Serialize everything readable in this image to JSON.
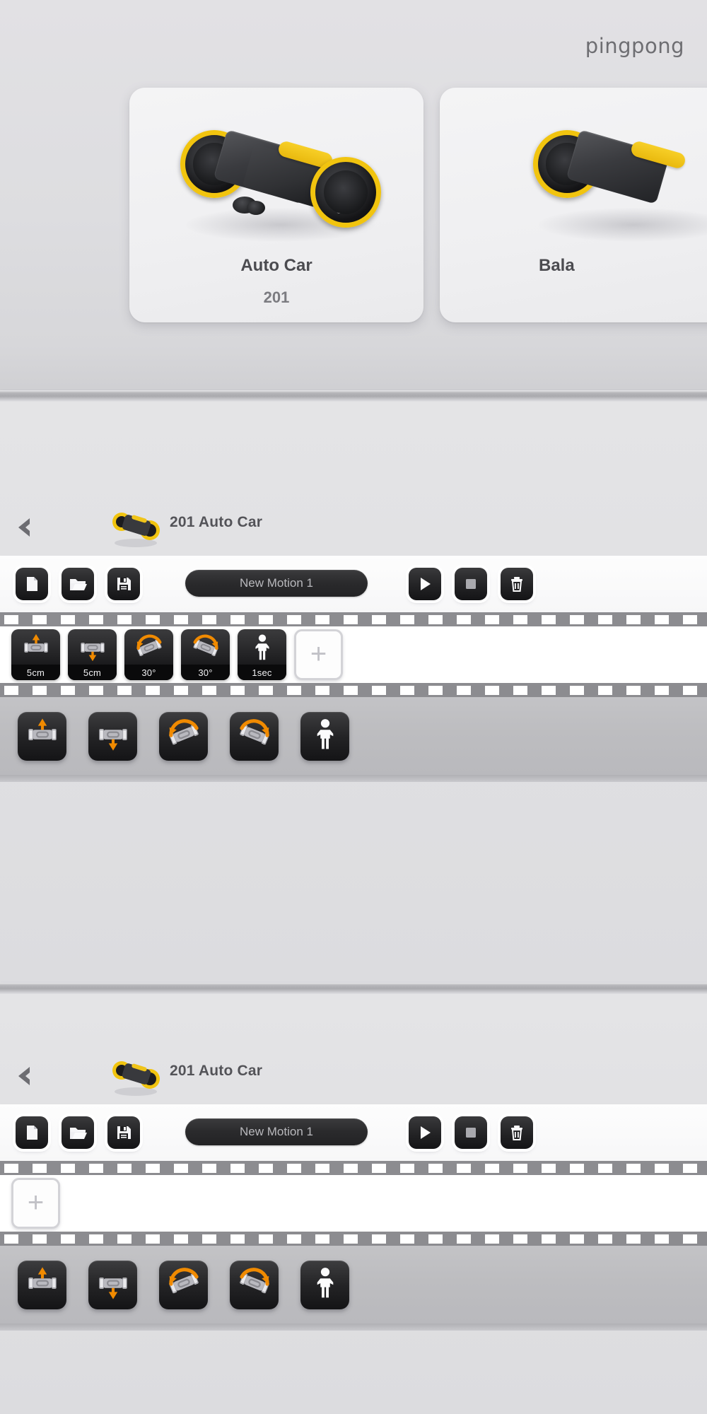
{
  "brand": "pingpong",
  "picker": {
    "cards": [
      {
        "title": "Auto Car",
        "number": "201",
        "icon": "auto-car-robot"
      },
      {
        "title": "Bala",
        "number": "",
        "icon": "balance-robot"
      }
    ]
  },
  "editors": [
    {
      "id": "editor-top",
      "header": {
        "back_icon": "chevron-left-icon",
        "thumb_icon": "auto-car-thumbnail",
        "title": "201 Auto Car"
      },
      "toolbar": {
        "new_label": "new-file-icon",
        "open_label": "open-folder-icon",
        "save_label": "save-disk-icon",
        "motion_name": "New Motion 1",
        "play_label": "play-icon",
        "stop_label": "stop-icon",
        "delete_label": "trash-icon"
      },
      "frames": [
        {
          "icon": "move-up-icon",
          "label": "5cm"
        },
        {
          "icon": "move-down-icon",
          "label": "5cm"
        },
        {
          "icon": "rotate-left-icon",
          "label": "30°"
        },
        {
          "icon": "rotate-right-icon",
          "label": "30°"
        },
        {
          "icon": "wait-person-icon",
          "label": "1sec"
        }
      ],
      "add_frame_label": "+",
      "palette": [
        {
          "icon": "move-up-icon"
        },
        {
          "icon": "move-down-icon"
        },
        {
          "icon": "rotate-left-icon"
        },
        {
          "icon": "rotate-right-icon"
        },
        {
          "icon": "wait-person-icon"
        }
      ]
    },
    {
      "id": "editor-bottom",
      "header": {
        "back_icon": "chevron-left-icon",
        "thumb_icon": "auto-car-thumbnail",
        "title": "201 Auto Car"
      },
      "toolbar": {
        "new_label": "new-file-icon",
        "open_label": "open-folder-icon",
        "save_label": "save-disk-icon",
        "motion_name": "New Motion 1",
        "play_label": "play-icon",
        "stop_label": "stop-icon",
        "delete_label": "trash-icon"
      },
      "frames": [],
      "add_frame_label": "+",
      "palette": [
        {
          "icon": "move-up-icon"
        },
        {
          "icon": "move-down-icon"
        },
        {
          "icon": "rotate-left-icon"
        },
        {
          "icon": "rotate-right-icon"
        },
        {
          "icon": "wait-person-icon"
        }
      ]
    }
  ],
  "colors": {
    "accent_orange": "#f08a00",
    "robot_yellow": "#f1c40f",
    "panel_dark": "#1e1e20",
    "background": "#dedee1"
  }
}
